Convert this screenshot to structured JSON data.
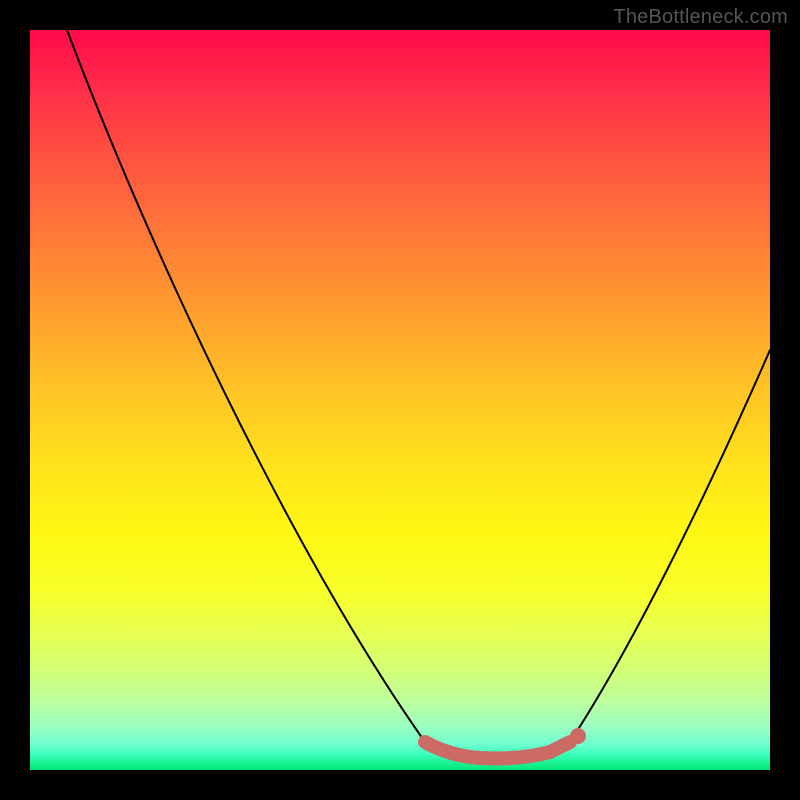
{
  "watermark": "TheBottleneck.com",
  "chart_data": {
    "type": "line",
    "title": "",
    "xlabel": "",
    "ylabel": "",
    "xlim": [
      0,
      100
    ],
    "ylim": [
      0,
      100
    ],
    "grid": false,
    "legend": false,
    "series": [
      {
        "name": "left-descending-curve",
        "x": [
          5,
          10,
          20,
          30,
          40,
          50,
          55
        ],
        "y": [
          100,
          85,
          62,
          42,
          24,
          8,
          2
        ]
      },
      {
        "name": "right-ascending-curve",
        "x": [
          74,
          80,
          88,
          100
        ],
        "y": [
          2,
          12,
          30,
          58
        ]
      },
      {
        "name": "bottom-flat-segment",
        "x": [
          55,
          60,
          65,
          70,
          74
        ],
        "y": [
          2,
          1,
          1,
          1,
          2
        ]
      }
    ],
    "background_gradient": {
      "orientation": "vertical",
      "stops": [
        {
          "pos": 0.0,
          "color": "#ff0a4a"
        },
        {
          "pos": 0.5,
          "color": "#ffd024"
        },
        {
          "pos": 0.8,
          "color": "#f0ff40"
        },
        {
          "pos": 1.0,
          "color": "#00e676"
        }
      ]
    },
    "annotations": [
      {
        "text": "TheBottleneck.com",
        "position": "top-right",
        "role": "watermark"
      }
    ]
  }
}
